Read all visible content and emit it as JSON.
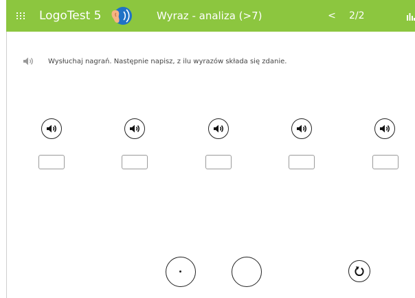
{
  "header": {
    "app_title": "LogoTest 5",
    "module_title": "Wyraz - analiza (>7)",
    "prev_label": "<",
    "page_counter": "2/2",
    "icons": [
      "grid-icon",
      "ear-logo-icon",
      "stats-icon"
    ],
    "background_color": "#8cc63f"
  },
  "task": {
    "instruction": "Wysłuchaj nagrań. Następnie napisz, z ilu wyrazów składa się zdanie.",
    "instruction_icon": "speaker-icon"
  },
  "words": [
    {
      "play_icon": "speaker-icon",
      "answer_value": ""
    },
    {
      "play_icon": "speaker-icon",
      "answer_value": ""
    },
    {
      "play_icon": "speaker-icon",
      "answer_value": ""
    },
    {
      "play_icon": "speaker-icon",
      "answer_value": ""
    },
    {
      "play_icon": "speaker-icon",
      "answer_value": ""
    }
  ],
  "controls": {
    "dot_button_icon": "dot-icon",
    "empty_button_icon": "",
    "reset_button_icon": "reset-icon"
  }
}
